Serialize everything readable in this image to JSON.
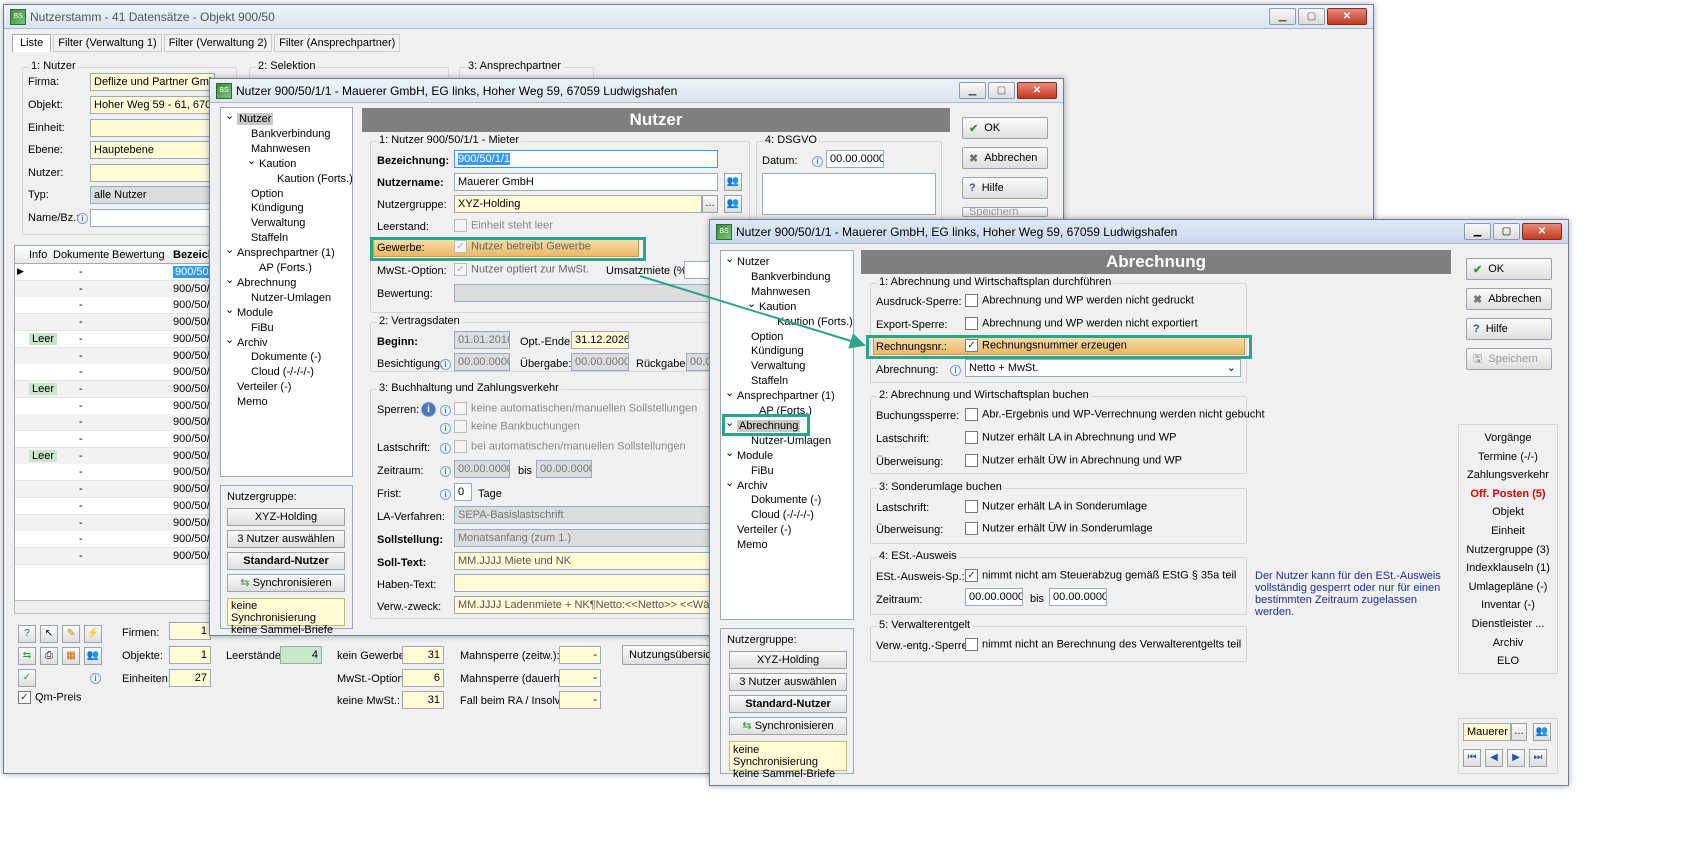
{
  "bg": {
    "title": "Nutzerstamm - 41 Datensätze - Objekt 900/50",
    "tabs": [
      "Liste",
      "Filter (Verwaltung 1)",
      "Filter (Verwaltung 2)",
      "Filter (Ansprechpartner)"
    ],
    "group1": "1: Nutzer",
    "group2": "2: Selektion",
    "group3": "3: Ansprechpartner",
    "firma_label": "Firma:",
    "firma_value": "Deflize und Partner GmbH",
    "objekt_label": "Objekt:",
    "objekt_value": "Hoher Weg 59 - 61, 67059",
    "einheit_label": "Einheit:",
    "ebene_label": "Ebene:",
    "ebene_value": "Hauptebene",
    "nutzer_label": "Nutzer:",
    "typ_label": "Typ:",
    "typ_value": "alle Nutzer",
    "name_label": "Name/Bz.:",
    "cols": [
      "Info",
      "Dokumente",
      "Bewertung",
      "Bezeich"
    ],
    "rows": [
      {
        "info": "",
        "doc": "-",
        "bez": "900/50/1"
      },
      {
        "info": "",
        "doc": "-",
        "bez": "900/50/1"
      },
      {
        "info": "",
        "doc": "-",
        "bez": "900/50/1"
      },
      {
        "info": "",
        "doc": "-",
        "bez": "900/50/1"
      },
      {
        "info": "Leer",
        "doc": "-",
        "bez": "900/50/1"
      },
      {
        "info": "",
        "doc": "-",
        "bez": "900/50/1"
      },
      {
        "info": "",
        "doc": "-",
        "bez": "900/50/1"
      },
      {
        "info": "Leer",
        "doc": "-",
        "bez": "900/50/1"
      },
      {
        "info": "",
        "doc": "-",
        "bez": "900/50/1"
      },
      {
        "info": "",
        "doc": "-",
        "bez": "900/50/1"
      },
      {
        "info": "",
        "doc": "-",
        "bez": "900/50/1"
      },
      {
        "info": "Leer",
        "doc": "-",
        "bez": "900/50/1"
      },
      {
        "info": "",
        "doc": "-",
        "bez": "900/50/1"
      },
      {
        "info": "",
        "doc": "-",
        "bez": "900/50/2"
      },
      {
        "info": "",
        "doc": "-",
        "bez": "900/50/2"
      },
      {
        "info": "",
        "doc": "-",
        "bez": "900/50/2"
      },
      {
        "info": "",
        "doc": "-",
        "bez": "900/50/2"
      },
      {
        "info": "",
        "doc": "-",
        "bez": "900/50/2"
      }
    ],
    "stats": {
      "firmen": "Firmen:",
      "firmen_v": "1",
      "objekte": "Objekte:",
      "objekte_v": "1",
      "einheiten": "Einheiten:",
      "einheiten_v": "27",
      "leer": "Leerstände:",
      "leer_v": "4",
      "kein_gew": "kein Gewerbe:",
      "kein_gew_v": "31",
      "mwst": "MwSt.-Option:",
      "mwst_v": "6",
      "keine_mwst": "keine MwSt.:",
      "keine_mwst_v": "31",
      "mahn1": "Mahnsperre (zeitw.):",
      "mahn1_v": "-",
      "mahn2": "Mahnsperre (dauerh.):",
      "mahn2_v": "-",
      "fall": "Fall beim RA / Insolv:",
      "fall_v": "-",
      "nutzungs": "Nutzungsübersicht",
      "qm": "Qm-Preis"
    }
  },
  "mid": {
    "title": "Nutzer 900/50/1/1 - Mauerer GmbH, EG links, Hoher Weg 59, 67059 Ludwigshafen",
    "header": "Nutzer",
    "tree": [
      {
        "t": "Nutzer",
        "l": 0,
        "e": "v",
        "sel": true
      },
      {
        "t": "Bankverbindung",
        "l": 2
      },
      {
        "t": "Mahnwesen",
        "l": 2
      },
      {
        "t": "Kaution",
        "l": 1,
        "e": "v"
      },
      {
        "t": "Kaution (Forts.)",
        "l": 3
      },
      {
        "t": "Option",
        "l": 2
      },
      {
        "t": "Kündigung",
        "l": 2
      },
      {
        "t": "Verwaltung",
        "l": 2
      },
      {
        "t": "Staffeln",
        "l": 2
      },
      {
        "t": "Ansprechpartner (1)",
        "l": 0,
        "e": "v"
      },
      {
        "t": "AP (Forts.)",
        "l": 1
      },
      {
        "t": "Abrechnung",
        "l": 0,
        "e": "v"
      },
      {
        "t": "Nutzer-Umlagen",
        "l": 2
      },
      {
        "t": "Module",
        "l": 0,
        "e": "v"
      },
      {
        "t": "FiBu",
        "l": 2
      },
      {
        "t": "Archiv",
        "l": 0,
        "e": "v"
      },
      {
        "t": "Dokumente (-)",
        "l": 2
      },
      {
        "t": "Cloud (-/-/-/-)",
        "l": 2
      },
      {
        "t": "Verteiler (-)",
        "l": 0
      },
      {
        "t": "Memo",
        "l": 0
      }
    ],
    "ng_label": "Nutzergruppe:",
    "ng_btn": "XYZ-Holding",
    "ng_select": "3 Nutzer auswählen",
    "ng_std": "Standard-Nutzer",
    "ng_sync": "Synchronisieren",
    "ng_note1": "keine Synchronisierung",
    "ng_note2": "keine Sammel-Briefe",
    "g1": "1: Nutzer 900/50/1/1 - Mieter",
    "bez_l": "Bezeichnung:",
    "bez_v": "900/50/1/1",
    "name_l": "Nutzername:",
    "name_v": "Mauerer GmbH",
    "grp_l": "Nutzergruppe:",
    "grp_v": "XYZ-Holding",
    "leer_l": "Leerstand:",
    "leer_c": "Einheit steht leer",
    "gew_l": "Gewerbe:",
    "gew_c": "Nutzer betreibt Gewerbe",
    "mwst_l": "MwSt.-Option:",
    "mwst_c": "Nutzer optiert zur MwSt.",
    "umsatz_l": "Umsatzmiete (%):",
    "bew_l": "Bewertung:",
    "g2": "2: Vertragsdaten",
    "beg_l": "Beginn:",
    "beg_v": "01.01.2016",
    "opt_l": "Opt.-Ende:",
    "opt_v": "31.12.2026",
    "bes_l": "Besichtigung:",
    "bes_v": "00.00.0000",
    "ueb_l": "Übergabe:",
    "ueb_v": "00.00.0000",
    "rue_l": "Rückgabe:",
    "rue_v": "00.00",
    "g3": "3: Buchhaltung und Zahlungsverkehr",
    "sp_l": "Sperren:",
    "sp_c1": "keine automatischen/manuellen Sollstellungen",
    "sp_c2": "keine Bankbuchungen",
    "ls_l": "Lastschrift:",
    "ls_c": "bei automatischen/manuellen Sollstellungen",
    "zr_l": "Zeitraum:",
    "zr_v1": "00.00.0000",
    "zr_bis": "bis",
    "zr_v2": "00.00.0000",
    "fr_l": "Frist:",
    "fr_v": "0",
    "fr_u": "Tage",
    "la_l": "LA-Verfahren:",
    "la_v": "SEPA-Basislastschrift",
    "soll_l": "Sollstellung:",
    "soll_v": "Monatsanfang (zum 1.)",
    "st_l": "Soll-Text:",
    "st_v": "MM.JJJJ Miete und NK",
    "ht_l": "Haben-Text:",
    "vz_l": "Verw.-zweck:",
    "vz_v": "MM.JJJJ Ladenmiete + NK¶Netto:<<Netto>> <<Währung>>",
    "g4": "4: DSGVO",
    "dat_l": "Datum:",
    "dat_v": "00.00.0000",
    "ok": "OK",
    "abbr": "Abbrechen",
    "hilfe": "Hilfe",
    "speich": "Speichern"
  },
  "front": {
    "title": "Nutzer 900/50/1/1 - Mauerer GmbH, EG links, Hoher Weg 59, 67059 Ludwigshafen",
    "header": "Abrechnung",
    "tree": [
      {
        "t": "Nutzer",
        "l": 0,
        "e": "v"
      },
      {
        "t": "Bankverbindung",
        "l": 2
      },
      {
        "t": "Mahnwesen",
        "l": 2
      },
      {
        "t": "Kaution",
        "l": 1,
        "e": "v"
      },
      {
        "t": "Kaution (Forts.)",
        "l": 3
      },
      {
        "t": "Option",
        "l": 2
      },
      {
        "t": "Kündigung",
        "l": 2
      },
      {
        "t": "Verwaltung",
        "l": 2
      },
      {
        "t": "Staffeln",
        "l": 2
      },
      {
        "t": "Ansprechpartner (1)",
        "l": 0,
        "e": "v"
      },
      {
        "t": "AP (Forts.)",
        "l": 1
      },
      {
        "t": "Abrechnung",
        "l": 0,
        "e": "v",
        "sel": true
      },
      {
        "t": "Nutzer-Umlagen",
        "l": 2
      },
      {
        "t": "Module",
        "l": 0,
        "e": "v"
      },
      {
        "t": "FiBu",
        "l": 2
      },
      {
        "t": "Archiv",
        "l": 0,
        "e": "v"
      },
      {
        "t": "Dokumente (-)",
        "l": 2
      },
      {
        "t": "Cloud (-/-/-/-)",
        "l": 2
      },
      {
        "t": "Verteiler (-)",
        "l": 0
      },
      {
        "t": "Memo",
        "l": 0
      }
    ],
    "ng_label": "Nutzergruppe:",
    "ng_btn": "XYZ-Holding",
    "ng_select": "3 Nutzer auswählen",
    "ng_std": "Standard-Nutzer",
    "ng_sync": "Synchronisieren",
    "ng_note1": "keine Synchronisierung",
    "ng_note2": "keine Sammel-Briefe",
    "g1": "1: Abrechnung und Wirtschaftsplan durchführen",
    "aus_l": "Ausdruck-Sperre:",
    "aus_c": "Abrechnung und WP werden nicht gedruckt",
    "exp_l": "Export-Sperre:",
    "exp_c": "Abrechnung und WP werden nicht exportiert",
    "rn_l": "Rechnungsnr.:",
    "rn_c": "Rechnungsnummer erzeugen",
    "abr_l": "Abrechnung:",
    "abr_v": "Netto + MwSt.",
    "g2": "2: Abrechnung und Wirtschaftsplan buchen",
    "bs_l": "Buchungssperre:",
    "bs_c": "Abr.-Ergebnis und WP-Verrechnung werden nicht gebucht",
    "ls_l": "Lastschrift:",
    "ls_c": "Nutzer erhält LA in Abrechnung und WP",
    "uw_l": "Überweisung:",
    "uw_c": "Nutzer erhält ÜW in Abrechnung und WP",
    "g3": "3: Sonderumlage buchen",
    "ls2_l": "Lastschrift:",
    "ls2_c": "Nutzer erhält LA in Sonderumlage",
    "uw2_l": "Überweisung:",
    "uw2_c": "Nutzer erhält ÜW in Sonderumlage",
    "g4": "4: ESt.-Ausweis",
    "est_l": "ESt.-Ausweis-Sp.:",
    "est_c": "nimmt nicht am Steuerabzug gemäß EStG § 35a teil",
    "zr_l": "Zeitraum:",
    "zr_v1": "00.00.0000",
    "zr_bis": "bis",
    "zr_v2": "00.00.0000",
    "est_note": "Der Nutzer kann für den ESt.-Ausweis vollständig gesperrt oder nur für einen bestimmten Zeitraum zugelassen werden.",
    "g5": "5: Verwalterentgelt",
    "ve_l": "Verw.-entg.-Sperre:",
    "ve_c": "nimmt nicht an Berechnung des Verwalterentgelts teil",
    "ok": "OK",
    "abbr": "Abbrechen",
    "hilfe": "Hilfe",
    "speich": "Speichern",
    "nav": [
      "Vorgänge",
      "Termine (-/-)",
      "Zahlungsverkehr",
      "Off. Posten (5)",
      "Objekt",
      "Einheit",
      "Nutzergruppe (3)",
      "Indexklauseln (1)",
      "Umlagepläne (-)",
      "Inventar (-)",
      "Dienstleister ...",
      "Archiv",
      "ELO"
    ],
    "search_v": "Mauerer"
  },
  "colors": {
    "accent_red": "#e00000",
    "highlight": "#2aa58a",
    "selection": "#3399ff"
  }
}
